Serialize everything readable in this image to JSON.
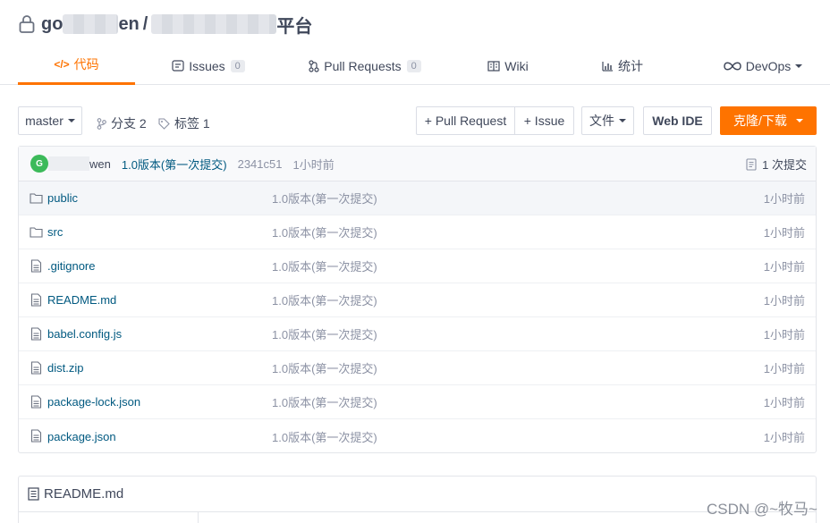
{
  "repo": {
    "owner_prefix": "go",
    "owner_suffix": "en",
    "separator": "/",
    "name_suffix": "平台"
  },
  "tabs": [
    {
      "label": "代码",
      "icon": "code-icon",
      "active": true
    },
    {
      "label": "Issues",
      "count": "0",
      "icon": "issues-icon"
    },
    {
      "label": "Pull Requests",
      "count": "0",
      "icon": "pull-request-icon"
    },
    {
      "label": "Wiki",
      "icon": "wiki-icon"
    },
    {
      "label": "统计",
      "icon": "stats-icon"
    },
    {
      "label": "DevOps",
      "icon": "devops-icon",
      "dropdown": true
    }
  ],
  "toolbar": {
    "branch": "master",
    "branches_label": "分支 2",
    "tags_label": "标签 1",
    "new_pr_label": "+ Pull Request",
    "new_issue_label": "+ Issue",
    "file_label": "文件",
    "web_ide_label": "Web IDE",
    "clone_label": "克隆/下载"
  },
  "commit": {
    "avatar_letter": "G",
    "author_suffix": "wen",
    "message": "1.0版本(第一次提交)",
    "sha": "2341c51",
    "time": "1小时前",
    "count_label": "1 次提交"
  },
  "files": [
    {
      "name": "public",
      "type": "folder",
      "message": "1.0版本(第一次提交)",
      "time": "1小时前"
    },
    {
      "name": "src",
      "type": "folder",
      "message": "1.0版本(第一次提交)",
      "time": "1小时前"
    },
    {
      "name": ".gitignore",
      "type": "file",
      "message": "1.0版本(第一次提交)",
      "time": "1小时前"
    },
    {
      "name": "README.md",
      "type": "file",
      "message": "1.0版本(第一次提交)",
      "time": "1小时前"
    },
    {
      "name": "babel.config.js",
      "type": "file",
      "message": "1.0版本(第一次提交)",
      "time": "1小时前"
    },
    {
      "name": "dist.zip",
      "type": "file",
      "message": "1.0版本(第一次提交)",
      "time": "1小时前"
    },
    {
      "name": "package-lock.json",
      "type": "file",
      "message": "1.0版本(第一次提交)",
      "time": "1小时前"
    },
    {
      "name": "package.json",
      "type": "file",
      "message": "1.0版本(第一次提交)",
      "time": "1小时前"
    }
  ],
  "readme": {
    "title": "README.md"
  },
  "watermark": "CSDN @~牧马~",
  "colors": {
    "accent": "#fe7300",
    "link": "#005980",
    "muted": "#8c92a4",
    "text": "#40485b"
  }
}
